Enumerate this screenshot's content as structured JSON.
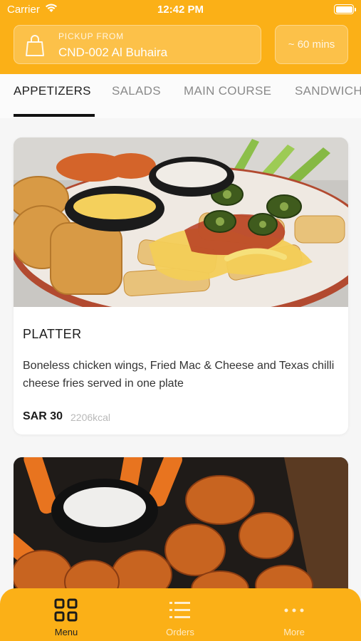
{
  "status_bar": {
    "carrier": "Carrier",
    "time": "12:42 PM"
  },
  "header": {
    "pickup_label": "PICKUP FROM",
    "branch_name": "CND-002 Al Buhaira",
    "eta": "~ 60 mins"
  },
  "categories": [
    {
      "label": "APPETIZERS",
      "active": true
    },
    {
      "label": "SALADS",
      "active": false
    },
    {
      "label": "MAIN COURSE",
      "active": false
    },
    {
      "label": "SANDWICH",
      "active": false
    }
  ],
  "items": [
    {
      "title": "PLATTER",
      "description": "Boneless chicken wings, Fried Mac & Cheese and Texas chilli cheese fries served in one plate",
      "price": "SAR 30",
      "kcal": "2206kcal"
    }
  ],
  "tab_bar": [
    {
      "label": "Menu",
      "icon": "grid-icon",
      "active": true
    },
    {
      "label": "Orders",
      "icon": "list-icon",
      "active": false
    },
    {
      "label": "More",
      "icon": "more-icon",
      "active": false
    }
  ],
  "colors": {
    "brand": "#fbb017",
    "text": "#1c1c1c"
  }
}
